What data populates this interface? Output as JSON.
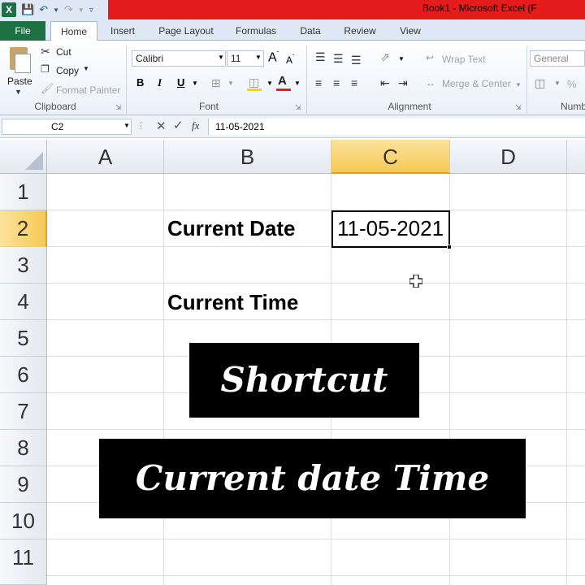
{
  "window": {
    "title": "Book1 - Microsoft Excel (F",
    "qat": [
      "excel-icon",
      "save-icon",
      "undo-icon",
      "undo-dropdown-icon",
      "redo-icon",
      "redo-dropdown-icon",
      "customize-qat-icon"
    ]
  },
  "ribbon": {
    "file_label": "File",
    "tabs": [
      "Home",
      "Insert",
      "Page Layout",
      "Formulas",
      "Data",
      "Review",
      "View"
    ],
    "clipboard": {
      "paste": "Paste",
      "cut": "Cut",
      "copy": "Copy",
      "format_painter": "Format Painter",
      "group": "Clipboard"
    },
    "font": {
      "name": "Calibri",
      "size": "11",
      "bold": "B",
      "italic": "I",
      "underline": "U",
      "group": "Font"
    },
    "alignment": {
      "wrap_text": "Wrap Text",
      "merge_center": "Merge & Center",
      "group": "Alignment"
    },
    "number": {
      "format": "General",
      "percent": "%",
      "group": "Numb"
    }
  },
  "formula_bar": {
    "name_box": "C2",
    "fx": "fx",
    "content": "11-05-2021"
  },
  "grid": {
    "columns": [
      "A",
      "B",
      "C",
      "D"
    ],
    "rows": [
      "1",
      "2",
      "3",
      "4",
      "5",
      "6",
      "7",
      "8",
      "9",
      "10",
      "11"
    ],
    "selected_column": "C",
    "selected_row": "2",
    "cells": {
      "B2": "Current Date",
      "C2": "11-05-2021",
      "B4": "Current Time"
    }
  },
  "overlays": {
    "line1": "Shortcut",
    "line2": "Current date Time"
  },
  "colors": {
    "title_banner": "#e51c1c",
    "file_tab": "#1e7145",
    "selection_header": "#f6c956"
  }
}
